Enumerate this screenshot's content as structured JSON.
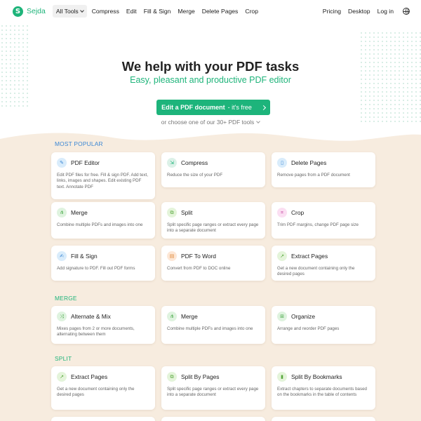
{
  "header": {
    "logo_text": "Sejda",
    "logo_letter": "S",
    "nav": [
      "All Tools",
      "Compress",
      "Edit",
      "Fill & Sign",
      "Merge",
      "Delete Pages",
      "Crop"
    ],
    "right": [
      "Pricing",
      "Desktop",
      "Log in"
    ]
  },
  "hero": {
    "title": "We help with your PDF tasks",
    "subtitle": "Easy, pleasant and productive PDF editor",
    "cta_main": "Edit a PDF document",
    "cta_suffix": " - it's free",
    "choose": "or choose one of our 30+ PDF tools"
  },
  "sections": {
    "popular": "MOST POPULAR",
    "merge": "MERGE",
    "split": "SPLIT"
  },
  "cards": [
    {
      "title": "PDF Editor",
      "desc": "Edit PDF files for free. Fill & sign PDF. Add text, links, images and shapes. Edit existing PDF text. Annotate PDF",
      "icon": "pencil-icon"
    },
    {
      "title": "Compress",
      "desc": "Reduce the size of your PDF",
      "icon": "compress-icon"
    },
    {
      "title": "Delete Pages",
      "desc": "Remove pages from a PDF document",
      "icon": "trash-icon"
    },
    {
      "title": "Merge",
      "desc": "Combine multiple PDFs and images into one",
      "icon": "merge-icon"
    },
    {
      "title": "Split",
      "desc": "Split specific page ranges or extract every page into a separate document",
      "icon": "split-icon"
    },
    {
      "title": "Crop",
      "desc": "Trim PDF margins, change PDF page size",
      "icon": "crop-icon"
    },
    {
      "title": "Fill & Sign",
      "desc": "Add signature to PDF. Fill out PDF forms",
      "icon": "signature-icon"
    },
    {
      "title": "PDF To Word",
      "desc": "Convert from PDF to DOC online",
      "icon": "document-icon"
    },
    {
      "title": "Extract Pages",
      "desc": "Get a new document containing only the desired pages",
      "icon": "extract-icon"
    },
    {
      "title": "Alternate & Mix",
      "desc": "Mixes pages from 2 or more documents, alternating between them",
      "icon": "shuffle-icon"
    },
    {
      "title": "Merge",
      "desc": "Combine multiple PDFs and images into one",
      "icon": "merge-icon"
    },
    {
      "title": "Organize",
      "desc": "Arrange and reorder PDF pages",
      "icon": "organize-icon"
    },
    {
      "title": "Extract Pages",
      "desc": "Get a new document containing only the desired pages",
      "icon": "extract-icon"
    },
    {
      "title": "Split By Pages",
      "desc": "Split specific page ranges or extract every page into a separate document",
      "icon": "split-icon"
    },
    {
      "title": "Split By Bookmarks",
      "desc": "Extract chapters to separate documents based on the bookmarks in the table of contents",
      "icon": "bookmark-icon"
    }
  ]
}
